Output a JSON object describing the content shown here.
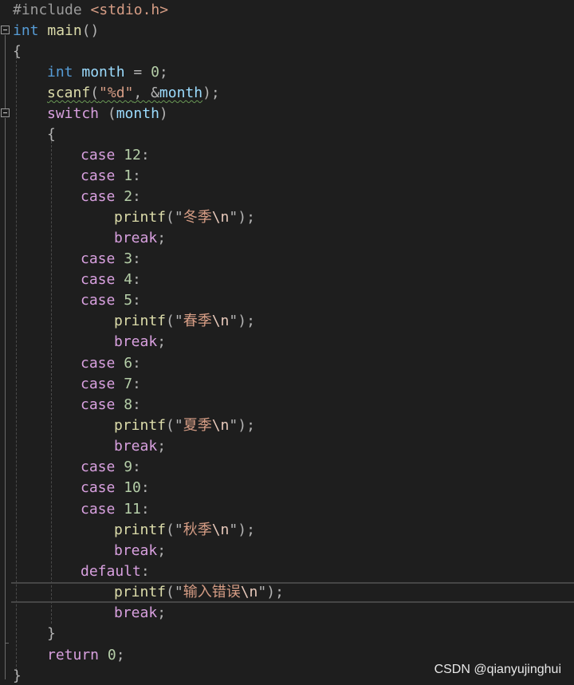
{
  "code": {
    "line1": {
      "directive": "#include",
      "header": "<stdio.h>"
    },
    "line2": {
      "type": "int",
      "name": "main",
      "parens": "()"
    },
    "line3": {
      "brace": "{"
    },
    "line4": {
      "type": "int",
      "var": "month",
      "op": " = ",
      "value": "0",
      "semi": ";"
    },
    "line5": {
      "fn": "scanf",
      "open": "(",
      "str": "\"%d\"",
      "sep": ", &",
      "var": "month",
      "close": ");"
    },
    "line6": {
      "kw": "switch",
      "open": " (",
      "var": "month",
      "close": ")"
    },
    "line7": {
      "brace": "{"
    },
    "cases": [
      {
        "kw": "case",
        "num": "12",
        "colon": ":"
      },
      {
        "kw": "case",
        "num": "1",
        "colon": ":"
      },
      {
        "kw": "case",
        "num": "2",
        "colon": ":"
      },
      {
        "kw": "case",
        "num": "3",
        "colon": ":"
      },
      {
        "kw": "case",
        "num": "4",
        "colon": ":"
      },
      {
        "kw": "case",
        "num": "5",
        "colon": ":"
      },
      {
        "kw": "case",
        "num": "6",
        "colon": ":"
      },
      {
        "kw": "case",
        "num": "7",
        "colon": ":"
      },
      {
        "kw": "case",
        "num": "8",
        "colon": ":"
      },
      {
        "kw": "case",
        "num": "9",
        "colon": ":"
      },
      {
        "kw": "case",
        "num": "10",
        "colon": ":"
      },
      {
        "kw": "case",
        "num": "11",
        "colon": ":"
      }
    ],
    "printfs": [
      {
        "fn": "printf",
        "open": "(\"",
        "text": "冬季",
        "esc": "\\n",
        "close": "\");"
      },
      {
        "fn": "printf",
        "open": "(\"",
        "text": "春季",
        "esc": "\\n",
        "close": "\");"
      },
      {
        "fn": "printf",
        "open": "(\"",
        "text": "夏季",
        "esc": "\\n",
        "close": "\");"
      },
      {
        "fn": "printf",
        "open": "(\"",
        "text": "秋季",
        "esc": "\\n",
        "close": "\");"
      },
      {
        "fn": "printf",
        "open": "(\"",
        "text": "输入错误",
        "esc": "\\n",
        "close": "\");"
      }
    ],
    "break_kw": "break",
    "semi": ";",
    "default_kw": "default",
    "default_colon": ":",
    "close_switch": "}",
    "return": {
      "kw": "return",
      "value": "0",
      "semi": ";"
    },
    "close_main": "}"
  },
  "watermark": "CSDN @qianyujinghui",
  "colors": {
    "background": "#1e1e1e",
    "keyword": "#569cd6",
    "control": "#d8a0df",
    "function": "#dcdcaa",
    "variable": "#9cdcfe",
    "number": "#b5cea8",
    "string": "#d69d85"
  }
}
